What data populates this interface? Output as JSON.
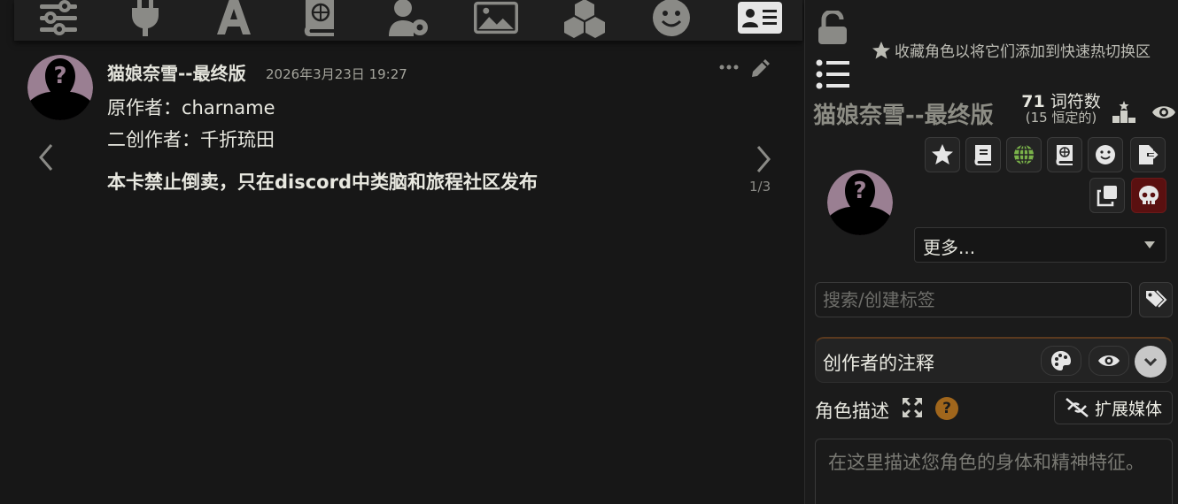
{
  "toolbar": {
    "icons": [
      "sliders-icon",
      "plug-icon",
      "font-icon",
      "book-atlas-icon",
      "user-gear-icon",
      "image-icon",
      "cubes-icon",
      "smile-icon",
      "address-card-icon"
    ],
    "active_index": 8
  },
  "message": {
    "name": "猫娘奈雪--最终版",
    "timestamp": "2026年3月23日 19:27",
    "lines": [
      "原作者：charname",
      "二创作者：千折琉田",
      "本卡禁止倒卖，只在discord中类脑和旅程社区发布"
    ],
    "swipe_counter": "1/3"
  },
  "panel": {
    "favorite_hint": "收藏角色以将它们添加到快速热切换区",
    "char_name": "猫娘奈雪--最终版",
    "token_count": "71",
    "token_label": "词符数",
    "token_permanent": "(15 恒定的)",
    "more_label": "更多...",
    "tag_placeholder": "搜索/创建标签",
    "creator_notes_title": "创作者的注释",
    "description_label": "角色描述",
    "help_glyph": "?",
    "extend_media_label": "扩展媒体",
    "description_placeholder": "在这里描述您角色的身体和精神特征。"
  },
  "colors": {
    "background": "#171717",
    "panel": "#1b1b1b",
    "globe": "#7ab24a",
    "danger": "#5a1010",
    "help": "#a0661c",
    "active_tab": "#e6e6e6"
  }
}
